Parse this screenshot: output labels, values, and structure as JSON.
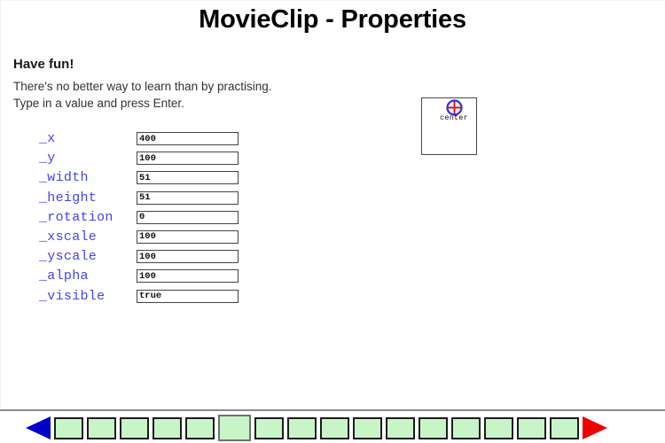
{
  "page": {
    "title": "MovieClip - Properties",
    "background_color": "#ffffff"
  },
  "intro": {
    "heading": "Have fun!",
    "line1": "There's no better way to learn than by practising.",
    "line2": "Type in a value and press Enter."
  },
  "properties": {
    "label_color": "#4444ee",
    "rows": [
      {
        "label": "_x",
        "value": "400"
      },
      {
        "label": "_y",
        "value": "100"
      },
      {
        "label": "_width",
        "value": "51"
      },
      {
        "label": "_height",
        "value": "51"
      },
      {
        "label": "_rotation",
        "value": "0"
      },
      {
        "label": "_xscale",
        "value": "100"
      },
      {
        "label": "_yscale",
        "value": "100"
      },
      {
        "label": "_alpha",
        "value": "100"
      },
      {
        "label": "_visible",
        "value": "true"
      }
    ]
  },
  "stage": {
    "clip_label": "center",
    "registration_icon": "registration-point-icon",
    "icon_ring_color": "#3333cc",
    "icon_cross_color": "#dd1111",
    "icon_fill_color": "#e8e8f8"
  },
  "nav": {
    "prev_arrow": "prev-arrow-icon",
    "next_arrow": "next-arrow-icon",
    "prev_color": "#0000cc",
    "next_color": "#ee0000",
    "square_fill": "#c8f5c8",
    "square_border": "#1c1c1c",
    "current_index": 5,
    "squares": [
      {
        "index": 1
      },
      {
        "index": 2
      },
      {
        "index": 3
      },
      {
        "index": 4
      },
      {
        "index": 5
      },
      {
        "index": 6
      },
      {
        "index": 7
      },
      {
        "index": 8
      },
      {
        "index": 9
      },
      {
        "index": 10
      },
      {
        "index": 11
      },
      {
        "index": 12
      },
      {
        "index": 13
      },
      {
        "index": 14
      },
      {
        "index": 15
      },
      {
        "index": 16
      }
    ]
  }
}
